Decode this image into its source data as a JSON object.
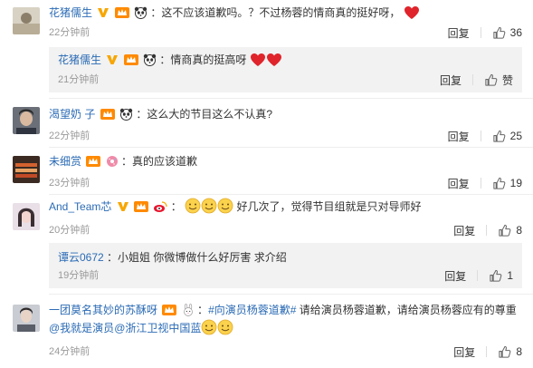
{
  "comments": [
    {
      "user": "花猪儒生",
      "text_a": "：这不应该道歉吗。？不过杨蓉的情商真的挺好呀，",
      "time": "22分钟前",
      "reply_label": "回复",
      "likes": "36",
      "reply": {
        "user": "花猪儒生",
        "text": "：情商真的挺高呀",
        "time": "21分钟前",
        "reply_label": "回复",
        "likes": "赞"
      }
    },
    {
      "user": "渴望奶 子",
      "text_a": "：这么大的节目这么不认真?",
      "time": "22分钟前",
      "reply_label": "回复",
      "likes": "25"
    },
    {
      "user": "未细赏",
      "text_a": "：真的应该道歉",
      "time": "23分钟前",
      "reply_label": "回复",
      "likes": "19"
    },
    {
      "user": "And_Team芯",
      "text_a": "：",
      "text_b": "好几次了，觉得节目组就是只对导师好",
      "time": "20分钟前",
      "reply_label": "回复",
      "likes": "8",
      "reply": {
        "user": "谭云0672",
        "text": "：小姐姐 你微博做什么好厉害 求介绍",
        "time": "19分钟前",
        "reply_label": "回复",
        "likes": "1"
      }
    },
    {
      "user": "一团莫名其妙的苏酥呀",
      "text_a": "：",
      "topic": "#向演员杨蓉道歉#",
      "text_b": " 请给演员杨蓉道歉，请给演员杨蓉应有的尊重",
      "mention_a": "@我就是演员",
      "mention_b": "@浙江卫视中国蓝",
      "time": "24分钟前",
      "reply_label": "回复",
      "likes": "8"
    }
  ],
  "colors": {
    "link": "#2b6bb5",
    "text": "#333333",
    "muted": "#999999",
    "reply_bg": "#f2f2f2",
    "heart": "#e0242b",
    "vip_badge": "#f7a600"
  },
  "icons": [
    "avatar",
    "verified-v-icon",
    "vip-crown-icon",
    "panda-icon",
    "heart-icon",
    "smile-emoji-icon",
    "thumbs-up-icon"
  ]
}
